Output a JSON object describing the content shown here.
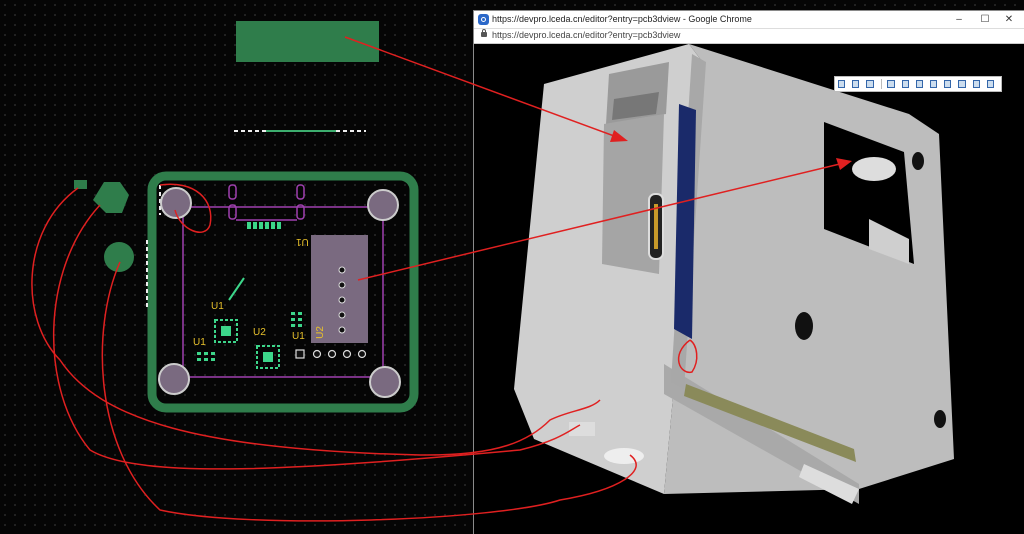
{
  "browser": {
    "title": "https://devpro.lceda.cn/editor?entry=pcb3dview - Google Chrome",
    "url": "https://devpro.lceda.cn/editor?entry=pcb3dview",
    "minimize_glyph": "–",
    "maximize_glyph": "☐",
    "close_glyph": "✕"
  },
  "pcb": {
    "labels": {
      "u1_top": "U1",
      "u1_small": "U1",
      "u1_left": "U1",
      "u2_chip": "U2",
      "u2_small": "U2",
      "u2_rot": "U2"
    }
  },
  "colors": {
    "board_green": "#2f7d4b",
    "silk_yellow": "#e8c12a",
    "annotation_red": "#e02020",
    "enclosure_gray": "#c8c8c8"
  }
}
